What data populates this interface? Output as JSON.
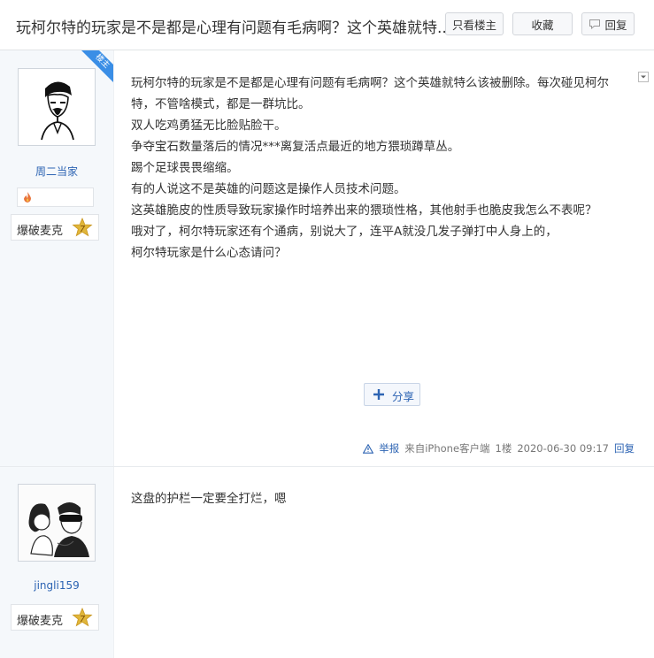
{
  "header": {
    "title": "玩柯尔特的玩家是不是都是心理有问题有毛病啊？这个英雄就特...",
    "only_op_label": "只看楼主",
    "favorite_label": "收藏",
    "reply_label": "回复"
  },
  "posts": [
    {
      "op_badge": "楼主",
      "username": "周二当家",
      "badge_label": "爆破麦克",
      "level": "7",
      "lines": [
        "玩柯尔特的玩家是不是都是心理有问题有毛病啊？这个英雄就特么该被删除。每次碰见柯尔",
        "特，不管啥模式，都是一群坑比。",
        "双人吃鸡勇猛无比脸贴脸干。",
        "争夺宝石数量落后的情况***离复活点最近的地方猥琐蹲草丛。",
        "踢个足球畏畏缩缩。",
        "有的人说这不是英雄的问题这是操作人员技术问题。",
        "这英雄脆皮的性质导致玩家操作时培养出来的猥琐性格，其他射手也脆皮我怎么不表呢？",
        "哦对了，柯尔特玩家还有个通病，别说大了，连平A就没几发子弹打中人身上的，",
        "柯尔特玩家是什么心态请问？"
      ],
      "share_label": "分享",
      "report_label": "举报",
      "source_label": "来自iPhone客户端",
      "floor": "1楼",
      "timestamp": "2020-06-30 09:17",
      "reply_label": "回复"
    },
    {
      "username": "jingli159",
      "badge_label": "爆破麦克",
      "level": "7",
      "lines": [
        "这盘的护栏一定要全打烂，嗯"
      ]
    }
  ],
  "colors": {
    "link_blue": "#2d64b3",
    "op_ribbon": "#3a8ee6",
    "level_gold": "#e0b63a"
  }
}
